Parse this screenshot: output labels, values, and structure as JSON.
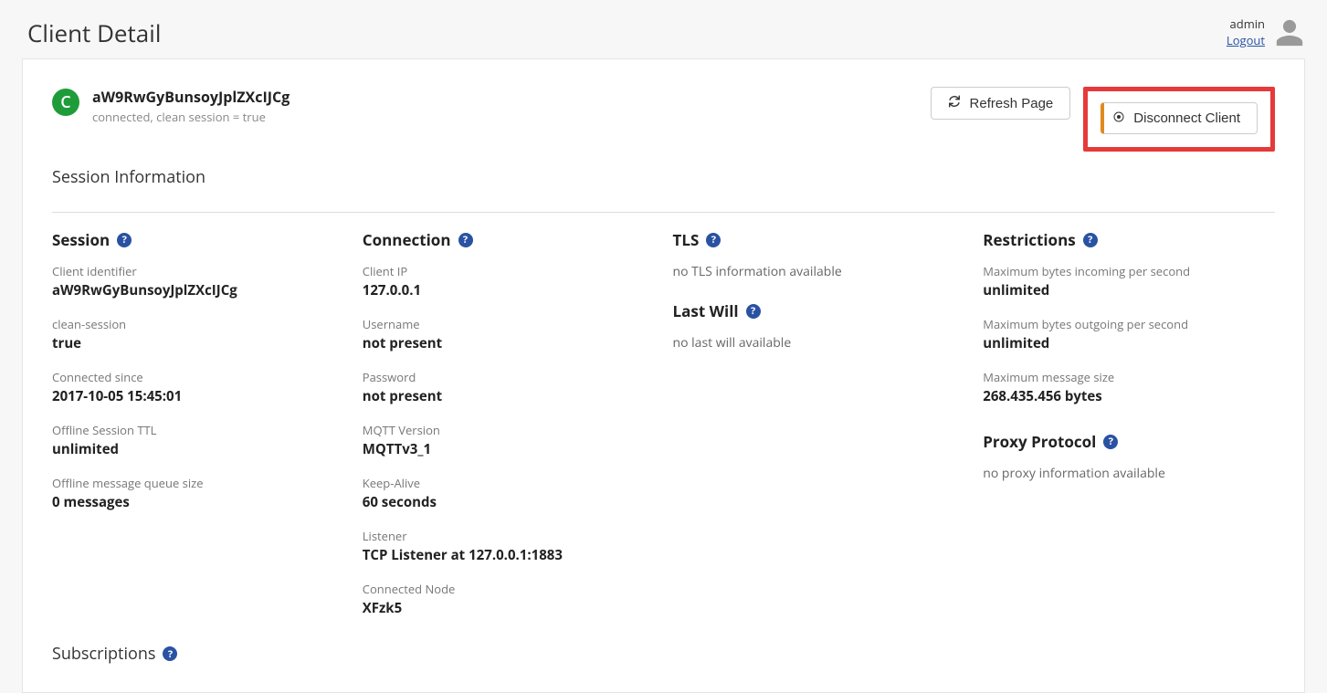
{
  "header": {
    "pageTitle": "Client Detail",
    "username": "admin",
    "logoutLabel": "Logout"
  },
  "client": {
    "badgeLetter": "C",
    "id": "aW9RwGyBunsoyJplZXcIJCg",
    "status": "connected, clean session = true"
  },
  "actions": {
    "refreshLabel": "Refresh Page",
    "disconnectLabel": "Disconnect Client"
  },
  "sections": {
    "sessionInfoTitle": "Session Information",
    "subscriptionsTitle": "Subscriptions"
  },
  "session": {
    "heading": "Session",
    "clientIdentifierLabel": "Client identifier",
    "clientIdentifierValue": "aW9RwGyBunsoyJplZXcIJCg",
    "cleanSessionLabel": "clean-session",
    "cleanSessionValue": "true",
    "connectedSinceLabel": "Connected since",
    "connectedSinceValue": "2017-10-05 15:45:01",
    "offlineTtlLabel": "Offline Session TTL",
    "offlineTtlValue": "unlimited",
    "offlineQueueLabel": "Offline message queue size",
    "offlineQueueValue": "0 messages"
  },
  "connection": {
    "heading": "Connection",
    "clientIpLabel": "Client IP",
    "clientIpValue": "127.0.0.1",
    "usernameLabel": "Username",
    "usernameValue": "not present",
    "passwordLabel": "Password",
    "passwordValue": "not present",
    "mqttVersionLabel": "MQTT Version",
    "mqttVersionValue": "MQTTv3_1",
    "keepAliveLabel": "Keep-Alive",
    "keepAliveValue": "60 seconds",
    "listenerLabel": "Listener",
    "listenerValue": "TCP Listener at 127.0.0.1:1883",
    "connectedNodeLabel": "Connected Node",
    "connectedNodeValue": "XFzk5"
  },
  "tls": {
    "heading": "TLS",
    "info": "no TLS information available"
  },
  "lastWill": {
    "heading": "Last Will",
    "info": "no last will available"
  },
  "restrictions": {
    "heading": "Restrictions",
    "maxBytesInLabel": "Maximum bytes incoming per second",
    "maxBytesInValue": "unlimited",
    "maxBytesOutLabel": "Maximum bytes outgoing per second",
    "maxBytesOutValue": "unlimited",
    "maxMsgSizeLabel": "Maximum message size",
    "maxMsgSizeValue": "268.435.456 bytes"
  },
  "proxy": {
    "heading": "Proxy Protocol",
    "info": "no proxy information available"
  }
}
